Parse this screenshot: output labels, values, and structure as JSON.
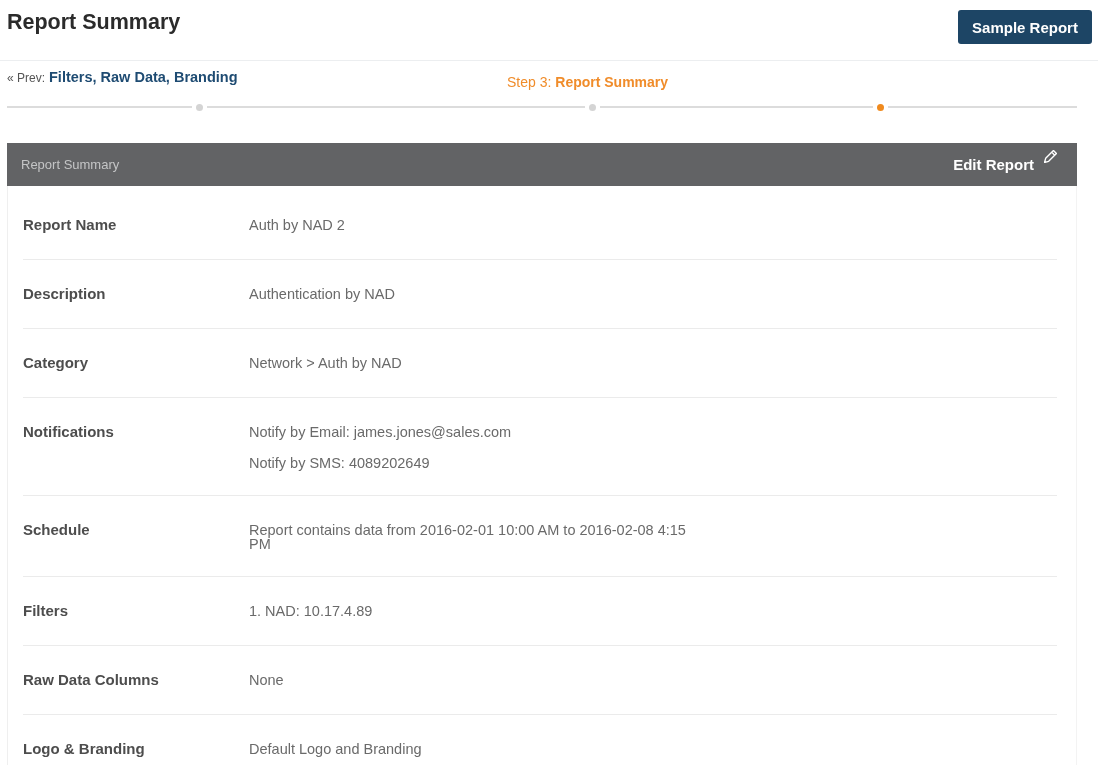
{
  "header": {
    "title": "Report Summary",
    "button": "Sample Report"
  },
  "wizard": {
    "prev_label": "« Prev:",
    "prev_link": "Filters, Raw Data, Branding",
    "current_step": "Step 3: **Report Summary**",
    "steps": [
      {
        "selected": false
      },
      {
        "selected": false
      },
      {
        "selected": true
      }
    ]
  },
  "panel": {
    "title": "Report Summary",
    "edit_button": "Edit Report",
    "rows": [
      {
        "label": "Report Name",
        "values": [
          "Auth by NAD 2"
        ]
      },
      {
        "label": "Description",
        "values": [
          "Authentication by NAD"
        ]
      },
      {
        "label": "Category",
        "values": [
          "Network > Auth by NAD"
        ]
      },
      {
        "label": "Notifications",
        "values": [
          "Notify by Email: james.jones@sales.com",
          "Notify by SMS: 4089202649"
        ]
      },
      {
        "label": "Schedule",
        "values": [
          "Report contains data from 2016-02-01 10:00 AM to 2016-02-08 4:15 PM"
        ]
      },
      {
        "label": "Filters",
        "values": [
          "1. NAD: 10.17.4.89"
        ]
      },
      {
        "label": "Raw Data Columns",
        "values": [
          "None"
        ]
      },
      {
        "label": "Logo & Branding",
        "values": [
          "Default Logo and Branding"
        ]
      }
    ]
  }
}
